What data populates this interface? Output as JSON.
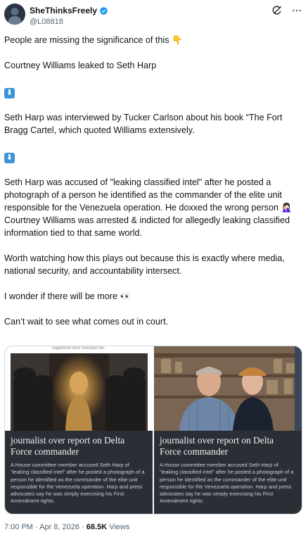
{
  "author": {
    "display_name": "SheThinksFreely",
    "handle": "@L08818"
  },
  "tweet": {
    "lines": [
      "People are missing the significance of this 👇",
      "Courtney Williams leaked to Seth Harp",
      "Seth Harp was interviewed by Tucker Carlson about his book “The Fort Bragg Cartel, which quoted Williams extensively.",
      "Seth Harp was accused of \"leaking classified intel\" after he posted a photograph of a person he identified as the commander of the elite unit responsible for the Venezuela operation.  He doxxed the wrong person 🤦🏻‍♀️",
      "Courtney Williams was arrested & indicted for allegedly leaking classified information tied to that same world.",
      "Worth watching how this plays out because this is exactly where media, national security, and accountability intersect.",
      "I wonder if there will be more 👀",
      "Can’t wait to see what comes out in court."
    ],
    "arrow_glyph": "⬇"
  },
  "media": {
    "left": {
      "top_strip": "happened next shocked her.",
      "title": "journalist over report on Delta Force commander",
      "body": "A House committee member accused Seth Harp of “leaking classified intel” after he posted a photograph of a person he identified as the commander of the elite unit responsible for the Venezuela operation. Harp and press advocates say he was simply exercising his First Amendment rights."
    },
    "right": {
      "title": "journalist over report on Delta Force commander",
      "body": "A House committee member accused Seth Harp of “leaking classified intel” after he posted a photograph of a person he identified as the commander of the elite unit responsible for the Venezuela operation. Harp and press advocates say he was simply exercising his First Amendment rights."
    }
  },
  "footer": {
    "timestamp": "7:00 PM · Apr 8, 2026 · ",
    "views_count": "68.5K",
    "views_label": " Views"
  },
  "icons": {
    "verified": "verified-badge-icon",
    "grok": "grok-icon",
    "more": "more-icon"
  },
  "colors": {
    "accent": "#1d9bf0",
    "text": "#0f1419",
    "muted": "#536471",
    "arrow_box": "#3b94d9"
  }
}
